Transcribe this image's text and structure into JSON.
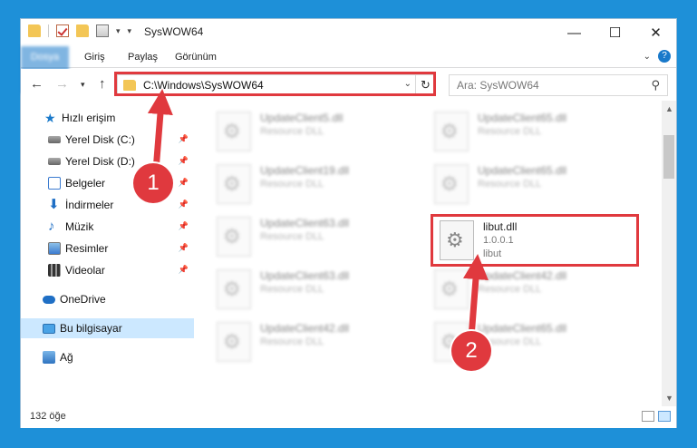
{
  "window": {
    "title": "SysWOW64",
    "minimize": "—",
    "maximize": "☐",
    "close": "✕"
  },
  "ribbon": {
    "tabs": [
      "Dosya",
      "Giriş",
      "Paylaş",
      "Görünüm"
    ],
    "help": "?"
  },
  "nav": {
    "address": "C:\\Windows\\SysWOW64",
    "search_placeholder": "Ara: SysWOW64"
  },
  "sidebar": {
    "items": [
      {
        "label": "Hızlı erişim"
      },
      {
        "label": "Yerel Disk (C:)"
      },
      {
        "label": "Yerel Disk (D:)"
      },
      {
        "label": "Belgeler"
      },
      {
        "label": "İndirmeler"
      },
      {
        "label": "Müzik"
      },
      {
        "label": "Resimler"
      },
      {
        "label": "Videolar"
      },
      {
        "label": "OneDrive"
      },
      {
        "label": "Bu bilgisayar"
      },
      {
        "label": "Ağ"
      }
    ]
  },
  "files": [
    {
      "name": "UpdateClient5.dll",
      "type": "Resource DLL"
    },
    {
      "name": "UpdateClient65.dll",
      "type": "Resource DLL"
    },
    {
      "name": "UpdateClient19.dll",
      "type": "Resource DLL"
    },
    {
      "name": "UpdateClient65.dll",
      "type": "Resource DLL"
    },
    {
      "name": "UpdateClient63.dll",
      "type": "Resource DLL"
    },
    {
      "name": "libut.dll",
      "version": "1.0.0.1",
      "desc": "libut"
    },
    {
      "name": "UpdateClient63.dll",
      "type": "Resource DLL"
    },
    {
      "name": "UpdateClient42.dll",
      "type": "Resource DLL"
    },
    {
      "name": "UpdateClient42.dll",
      "type": "Resource DLL"
    },
    {
      "name": "UpdateClient65.dll",
      "type": "Resource DLL"
    }
  ],
  "status": {
    "count": "132 öğe"
  },
  "annotations": {
    "marker1": "1",
    "marker2": "2",
    "color": "#e0393e"
  }
}
